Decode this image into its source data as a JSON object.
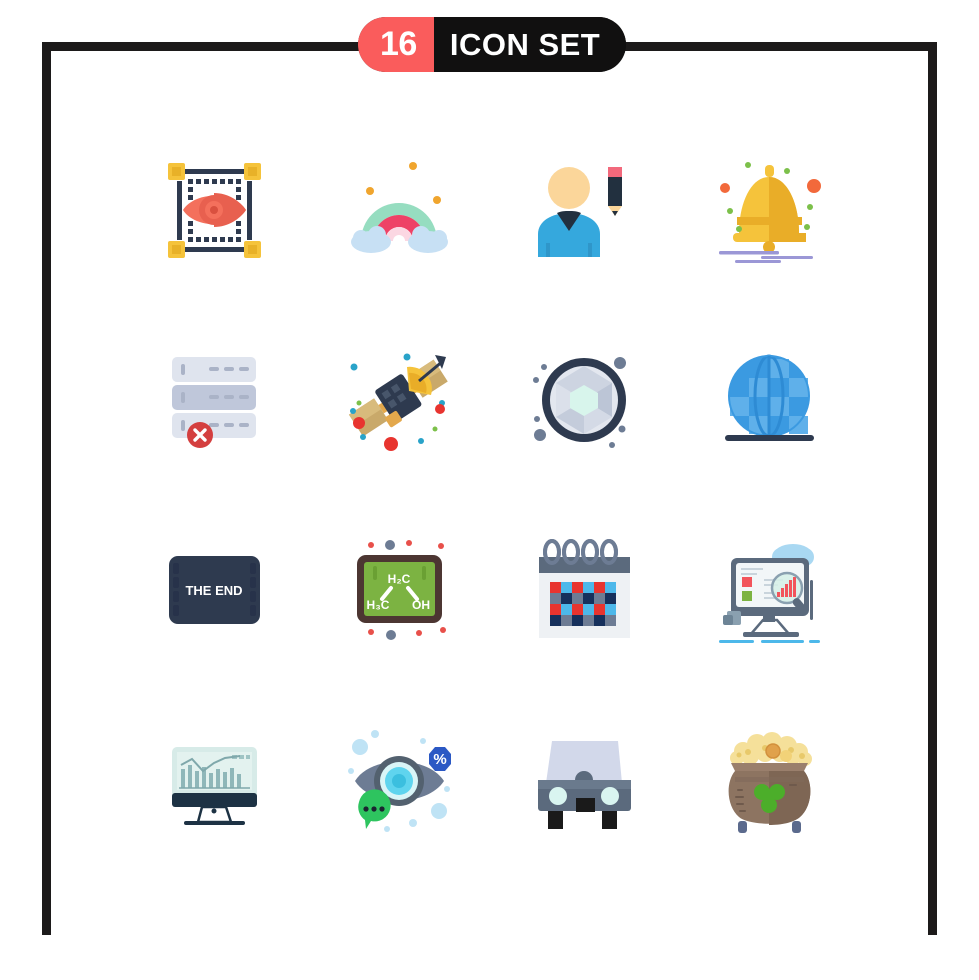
{
  "header": {
    "count": "16",
    "title": "ICON SET",
    "count_bg": "#fa5c5c",
    "title_bg": "#111010",
    "text_color": "#ffffff"
  },
  "frame": {
    "color": "#1c1a1a",
    "style": "open-bottom-bracket"
  },
  "palette": {
    "red": "#f05555",
    "salmon": "#f4705c",
    "dark_navy": "#2e3a4f",
    "yellow": "#f5c33b",
    "gold": "#f7b731",
    "mint": "#96ddc0",
    "pink": "#ee4266",
    "light_blue": "#c7e0f4",
    "blue": "#3b9ae1",
    "slate": "#5b6a7d",
    "green": "#7cb342",
    "brown": "#8d7461",
    "gray_blue": "#ccd3e0"
  },
  "grid": {
    "columns": 4,
    "rows": 4,
    "icons": [
      {
        "id": 1,
        "name": "eye-selection-icon",
        "label": "Vision / selection frame with eye"
      },
      {
        "id": 2,
        "name": "rainbow-icon",
        "label": "Rainbow with clouds"
      },
      {
        "id": 3,
        "name": "user-edit-icon",
        "label": "User avatar with pencil"
      },
      {
        "id": 4,
        "name": "bell-icon",
        "label": "Alarm bell with sparkles"
      },
      {
        "id": 5,
        "name": "server-error-icon",
        "label": "Server rack with error badge"
      },
      {
        "id": 6,
        "name": "satellite-icon",
        "label": "Satellite with dish"
      },
      {
        "id": 7,
        "name": "camera-shutter-icon",
        "label": "Camera aperture shutter"
      },
      {
        "id": 8,
        "name": "globe-icon",
        "label": "Globe on stand"
      },
      {
        "id": 9,
        "name": "the-end-film-icon",
        "label": "Film frame reading THE END"
      },
      {
        "id": 10,
        "name": "chemistry-board-icon",
        "label": "Chalkboard with chemical formula"
      },
      {
        "id": 11,
        "name": "calendar-icon",
        "label": "Spiral calendar with color grid"
      },
      {
        "id": 12,
        "name": "analytics-monitor-icon",
        "label": "Monitor with chart and magnifier"
      },
      {
        "id": 13,
        "name": "chart-monitor-icon",
        "label": "Monitor showing bar chart"
      },
      {
        "id": 14,
        "name": "eye-percent-chat-icon",
        "label": "Eye with percent badge and chat bubble"
      },
      {
        "id": 15,
        "name": "car-front-icon",
        "label": "Car front view"
      },
      {
        "id": 16,
        "name": "pot-of-gold-icon",
        "label": "Pot of gold with clover"
      }
    ]
  },
  "icon_text": {
    "the_end": "THE END",
    "formula_top": "H₂C",
    "formula_left": "H₃C",
    "formula_right": "OH",
    "percent": "%"
  }
}
